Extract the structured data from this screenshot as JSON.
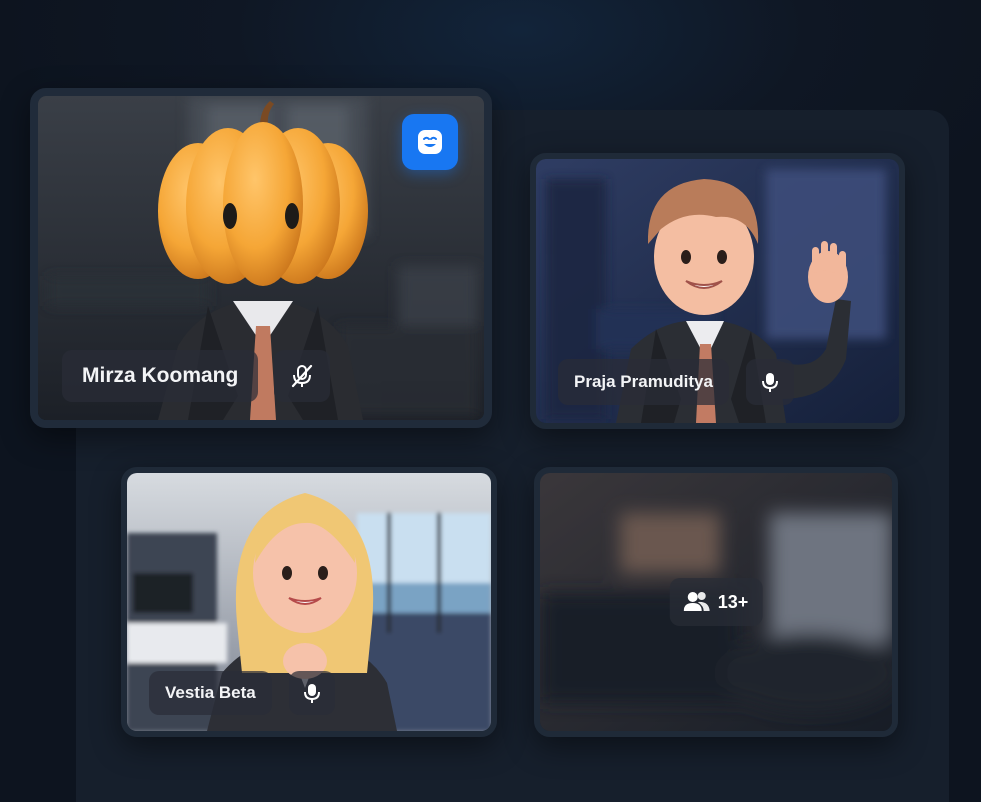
{
  "participants": [
    {
      "name": "Mirza Koomang",
      "mic": "muted"
    },
    {
      "name": "Praja Pramuditya",
      "mic": "on"
    },
    {
      "name": "Vestia Beta",
      "mic": "on"
    }
  ],
  "overflow": {
    "count_label": "13+",
    "icon": "users-icon"
  },
  "reaction_button": {
    "icon": "smile-face-icon",
    "color": "#1877f2"
  },
  "colors": {
    "background": "#0f1724",
    "panel": "#161f2c",
    "tile_border": "#1f2a38"
  }
}
